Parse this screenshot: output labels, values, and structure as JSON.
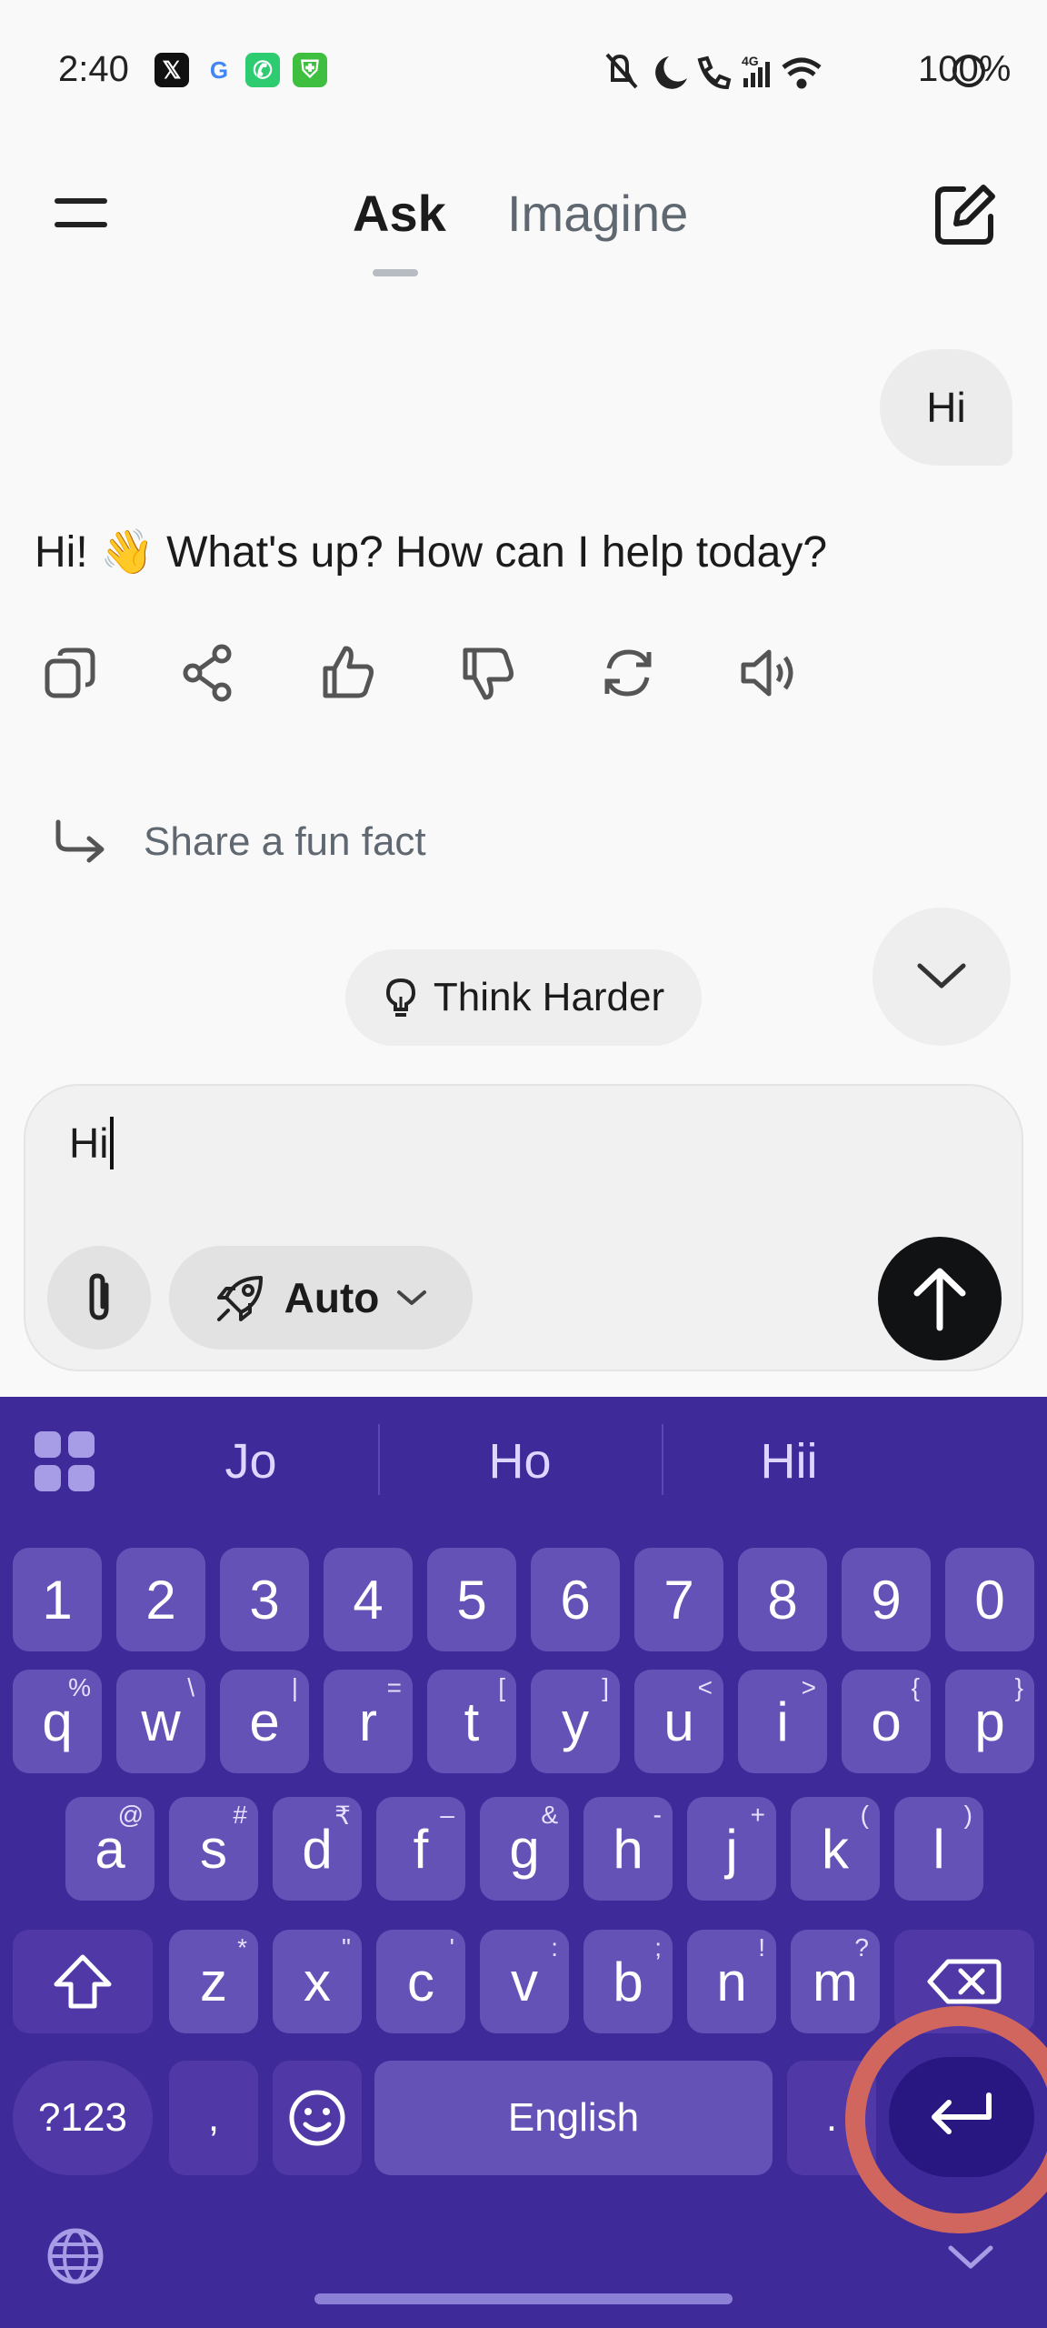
{
  "status_bar": {
    "time": "2:40",
    "battery": "100%",
    "notif_icons": [
      "x-icon",
      "google-icon",
      "phone-app-icon",
      "vpn-icon"
    ],
    "system_icons": [
      "mute-icon",
      "dnd-moon-icon",
      "wifi-call-icon",
      "signal-4g-icon",
      "wifi-icon",
      "battery-icon"
    ]
  },
  "header": {
    "menu_icon": "hamburger-icon",
    "tabs": [
      {
        "label": "Ask",
        "active": true
      },
      {
        "label": "Imagine",
        "active": false
      }
    ],
    "new_chat_icon": "edit-icon"
  },
  "chat": {
    "user_message": "Hi",
    "ai_message": "Hi! 👋 What's up? How can I help today?",
    "actions": [
      "copy-icon",
      "share-icon",
      "thumbs-up-icon",
      "thumbs-down-icon",
      "regenerate-icon",
      "speaker-icon"
    ],
    "suggestion": "Share a fun fact"
  },
  "think_harder": {
    "label": "Think Harder"
  },
  "composer": {
    "value": "Hi",
    "mode_label": "Auto"
  },
  "keyboard": {
    "suggestions": [
      "Jo",
      "Ho",
      "Hii"
    ],
    "number_row": [
      "1",
      "2",
      "3",
      "4",
      "5",
      "6",
      "7",
      "8",
      "9",
      "0"
    ],
    "row1": [
      {
        "k": "q",
        "s": "%"
      },
      {
        "k": "w",
        "s": "\\"
      },
      {
        "k": "e",
        "s": "|"
      },
      {
        "k": "r",
        "s": "="
      },
      {
        "k": "t",
        "s": "["
      },
      {
        "k": "y",
        "s": "]"
      },
      {
        "k": "u",
        "s": "<"
      },
      {
        "k": "i",
        "s": ">"
      },
      {
        "k": "o",
        "s": "{"
      },
      {
        "k": "p",
        "s": "}"
      }
    ],
    "row2": [
      {
        "k": "a",
        "s": "@"
      },
      {
        "k": "s",
        "s": "#"
      },
      {
        "k": "d",
        "s": "₹"
      },
      {
        "k": "f",
        "s": "–"
      },
      {
        "k": "g",
        "s": "&"
      },
      {
        "k": "h",
        "s": "-"
      },
      {
        "k": "j",
        "s": "+"
      },
      {
        "k": "k",
        "s": "("
      },
      {
        "k": "l",
        "s": ")"
      }
    ],
    "row3": [
      {
        "k": "z",
        "s": "*"
      },
      {
        "k": "x",
        "s": "\""
      },
      {
        "k": "c",
        "s": "'"
      },
      {
        "k": "v",
        "s": ":"
      },
      {
        "k": "b",
        "s": ";"
      },
      {
        "k": "n",
        "s": "!"
      },
      {
        "k": "m",
        "s": "?"
      }
    ],
    "symbols_label": "?123",
    "comma": ",",
    "space_label": "English",
    "period": "."
  },
  "colors": {
    "keyboard_bg": "#3e2a98",
    "key_bg": "#6552b6",
    "enter_highlight": "#d1665f"
  }
}
